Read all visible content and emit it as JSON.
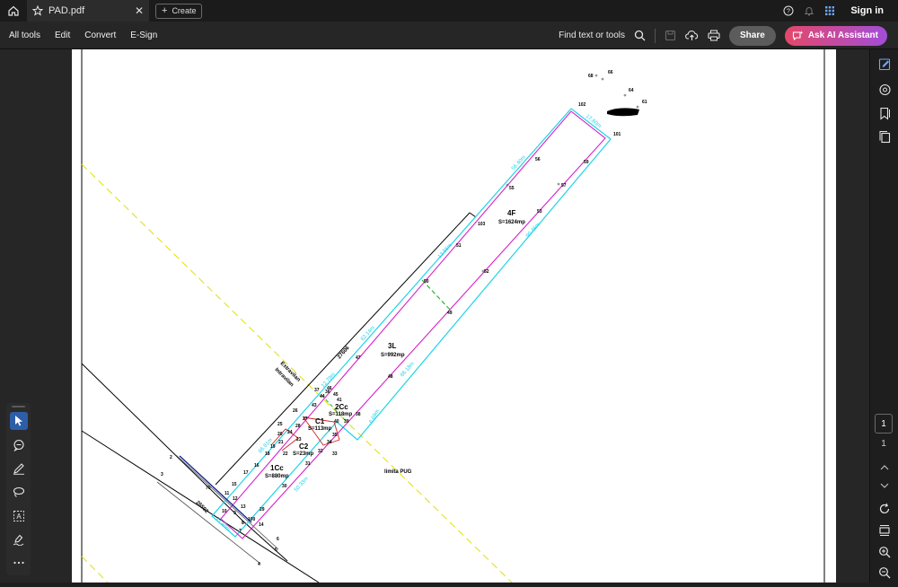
{
  "tabbar": {
    "tab_title": "PAD.pdf",
    "close_glyph": "✕",
    "create_label": "Create",
    "sign_in": "Sign in"
  },
  "toolbar": {
    "menu": [
      "All tools",
      "Edit",
      "Convert",
      "E-Sign"
    ],
    "find_label": "Find text or tools",
    "share_label": "Share",
    "ai_label": "Ask AI Assistant"
  },
  "navigation": {
    "current_page": "1",
    "total_pages": "1"
  },
  "colors": {
    "ai_gradient_start": "#e4486a",
    "ai_gradient_end": "#a24dd8",
    "active_tool": "#2d5ea8",
    "cyan_line": "#1fd3e8",
    "magenta_line": "#d620c8",
    "yellow_dash": "#e0e000",
    "green_dash": "#2db52d"
  },
  "icons": {
    "left_tools": [
      "select-cursor-icon",
      "comment-icon",
      "draw-pen-icon",
      "lasso-icon",
      "text-box-icon",
      "sign-icon",
      "more-icon"
    ],
    "right_rail": [
      "edit-pdf-icon",
      "comments-icon",
      "bookmark-icon",
      "pages-icon",
      "refresh-icon",
      "scroll-mode-icon",
      "zoom-in-icon",
      "zoom-out-icon"
    ]
  },
  "drawing": {
    "parcels": [
      {
        "name": "4F",
        "area": "S=1624mp"
      },
      {
        "name": "3L",
        "area": "S=992mp"
      },
      {
        "name": "2Cc",
        "area": "S=118mp"
      },
      {
        "name": "C1",
        "area": "S=113mp"
      },
      {
        "name": "C2",
        "area": "S=23mp"
      },
      {
        "name": "1Cc",
        "area": "S=880mp"
      }
    ],
    "labels": {
      "extravilan": "Extravilan",
      "intravilan": "Intravilan",
      "limita_pug": "limita PUG",
      "id_1": "27606",
      "id_2": "26502"
    },
    "dimensions": [
      "17.60m",
      "56.40m",
      "13.55m",
      "90.46m",
      "62.14m",
      "66.18m",
      "6.69m",
      "12.79m",
      "66.81m",
      "17.48m",
      "50.33m"
    ],
    "points": [
      "68",
      "66",
      "64",
      "61",
      "102",
      "101",
      "56",
      "59",
      "55",
      "57",
      "103",
      "53",
      "51",
      "52",
      "50",
      "49",
      "47",
      "48",
      "46",
      "45",
      "44",
      "41",
      "43",
      "40",
      "38",
      "39",
      "26",
      "27",
      "25",
      "28",
      "24",
      "21",
      "23",
      "35",
      "34",
      "20",
      "19",
      "18",
      "22",
      "33",
      "32",
      "31",
      "16",
      "17",
      "15",
      "70",
      "11",
      "12",
      "13",
      "10",
      "9",
      "29",
      "30",
      "8",
      "7",
      "14",
      "6",
      "5",
      "4",
      "2",
      "3",
      "100",
      "37",
      "36"
    ]
  }
}
